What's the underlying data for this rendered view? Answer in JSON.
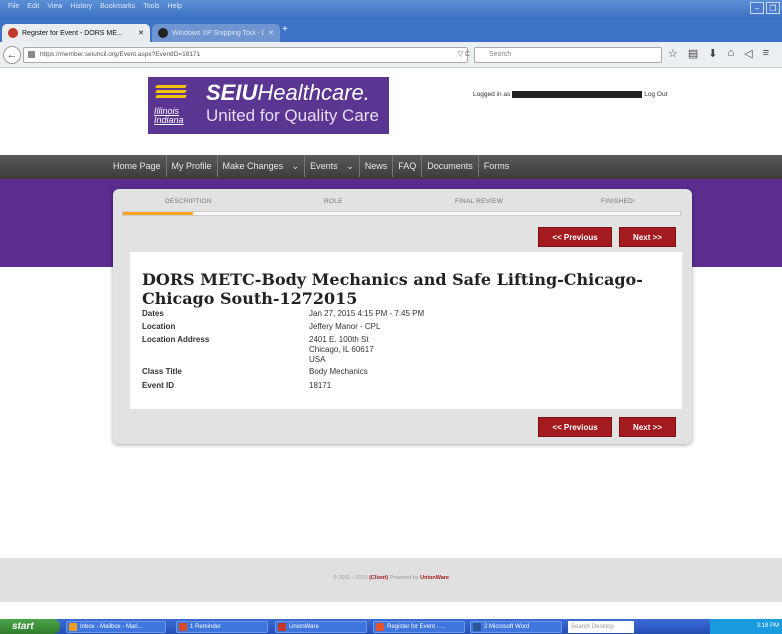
{
  "browser": {
    "menu": [
      "File",
      "Edit",
      "View",
      "History",
      "Bookmarks",
      "Tools",
      "Help"
    ],
    "tabs": [
      {
        "label": "Register for Event - DORS ME...",
        "active": true
      },
      {
        "label": "Windows XP Snipping Tool - D...",
        "active": false
      }
    ],
    "new_tab": "+",
    "close_glyph": "✕",
    "url": "https://member.seiuhcil.org/Event.aspx?EventID=18171",
    "reload_glyph": "▽ C",
    "search_placeholder": "Search"
  },
  "header": {
    "logo_state": "Illinois Indiana",
    "logo_brand_bold": "SEIU",
    "logo_brand_light": "Healthcare.",
    "logo_tagline": "United for Quality Care",
    "logged_in_prefix": "Logged in as",
    "logout_label": "Log Out"
  },
  "nav": {
    "items": [
      "Home Page",
      "My Profile",
      "Make Changes",
      "Events",
      "News",
      "FAQ",
      "Documents",
      "Forms"
    ]
  },
  "wizard": {
    "steps": [
      "DESCRIPTION",
      "ROLE",
      "FINAL REVIEW",
      "FINISHED!"
    ],
    "progress": 0.125,
    "prev_label": "<< Previous",
    "next_label": "Next >>"
  },
  "event": {
    "title": "DORS METC-Body Mechanics and Safe Lifting-Chicago-Chicago South-1272015",
    "fields": [
      {
        "label": "Dates",
        "value": [
          "Jan 27, 2015 4:15 PM - 7:45 PM"
        ]
      },
      {
        "label": "Location",
        "value": [
          "Jeffery Manor - CPL"
        ]
      },
      {
        "label": "Location Address",
        "value": [
          "2401 E. 100th St",
          "Chicago, IL 60617",
          "USA"
        ]
      },
      {
        "label": "Class Title",
        "value": [
          "Body Mechanics"
        ]
      },
      {
        "label": "Event ID",
        "value": [
          "18171"
        ]
      }
    ]
  },
  "footer": {
    "copyright": "© 2011 - 2015",
    "client": "(Client)",
    "powered": "Powered by",
    "vendor": "UnionWare"
  },
  "taskbar": {
    "start": "start",
    "items": [
      {
        "label": "Inbox - Mailbox - Mari...",
        "color": "#f0a020"
      },
      {
        "label": "1 Reminder",
        "color": "#d94a2a"
      },
      {
        "label": "UnionWare",
        "color": "#c0392b"
      },
      {
        "label": "Register for Event - ...",
        "color": "#e8542a"
      },
      {
        "label": "2 Microsoft Word",
        "color": "#2b579a"
      }
    ],
    "search_placeholder": "Search Desktop",
    "time": "3:18 PM"
  },
  "colors": {
    "brand_purple": "#5a2d8f",
    "button_red": "#a31b1e",
    "progress_orange": "#f6a623"
  }
}
